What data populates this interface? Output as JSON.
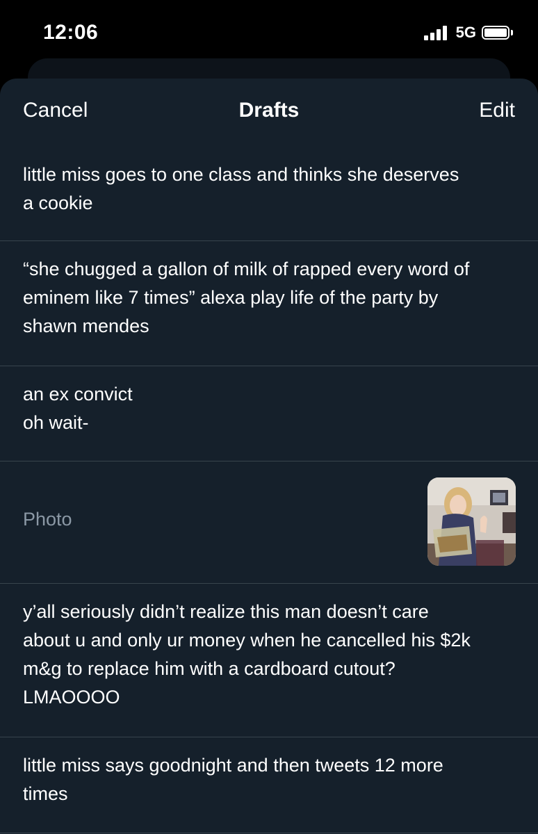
{
  "status_bar": {
    "time": "12:06",
    "network": "5G",
    "signal_bars": 4,
    "battery_level": 1.0,
    "icons": [
      "signal-icon",
      "battery-icon"
    ]
  },
  "header": {
    "cancel_label": "Cancel",
    "title": "Drafts",
    "edit_label": "Edit"
  },
  "drafts": [
    {
      "text": "little miss goes to one class and thinks she deserves\na cookie"
    },
    {
      "text": "“she chugged a gallon of milk of rapped every word of\neminem like 7 times” alexa play life of the party by\nshawn mendes"
    },
    {
      "text": "an ex convict\noh wait-"
    },
    {
      "label": "Photo",
      "media": "photo-thumbnail"
    },
    {
      "text": "y’all seriously didn’t realize this man doesn’t care\nabout u and only ur money when he cancelled his $2k\nm&g to replace him with a cardboard cutout?\nLMAOOOO"
    },
    {
      "text": "little miss says goodnight and then tweets 12 more\ntimes"
    }
  ],
  "colors": {
    "background": "#15202b",
    "divider": "#38444d",
    "muted_text": "#8b98a5"
  }
}
